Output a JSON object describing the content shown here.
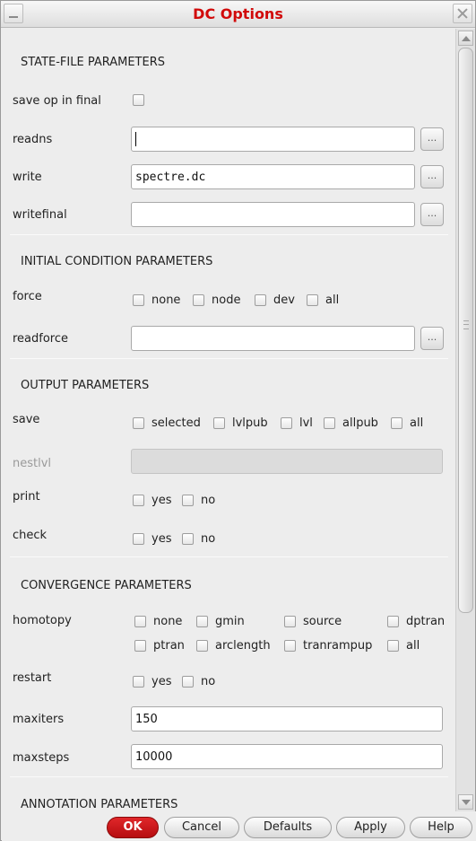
{
  "window": {
    "title": "DC Options"
  },
  "sections": {
    "state_file": {
      "title": "STATE-FILE PARAMETERS",
      "save_op_label": "save op in final",
      "readns_label": "readns",
      "readns_value": "",
      "write_label": "write",
      "write_value": "spectre.dc",
      "writefinal_label": "writefinal",
      "writefinal_value": "",
      "browse_label": "..."
    },
    "initial_condition": {
      "title": "INITIAL CONDITION PARAMETERS",
      "force_label": "force",
      "force_options": [
        "none",
        "node",
        "dev",
        "all"
      ],
      "readforce_label": "readforce",
      "readforce_value": ""
    },
    "output": {
      "title": "OUTPUT PARAMETERS",
      "save_label": "save",
      "save_options": [
        "selected",
        "lvlpub",
        "lvl",
        "allpub",
        "all"
      ],
      "nestlvl_label": "nestlvl",
      "print_label": "print",
      "print_options": [
        "yes",
        "no"
      ],
      "check_label": "check",
      "check_options": [
        "yes",
        "no"
      ]
    },
    "convergence": {
      "title": "CONVERGENCE PARAMETERS",
      "homotopy_label": "homotopy",
      "homotopy_options": [
        "none",
        "gmin",
        "source",
        "dptran",
        "ptran",
        "arclength",
        "tranrampup",
        "all"
      ],
      "restart_label": "restart",
      "restart_options": [
        "yes",
        "no"
      ],
      "maxiters_label": "maxiters",
      "maxiters_value": "150",
      "maxsteps_label": "maxsteps",
      "maxsteps_value": "10000"
    },
    "annotation": {
      "title": "ANNOTATION PARAMETERS"
    }
  },
  "buttons": {
    "ok": "OK",
    "cancel": "Cancel",
    "defaults": "Defaults",
    "apply": "Apply",
    "help": "Help"
  },
  "colors": {
    "title_red": "#d10a0a",
    "ok_red": "#c8161a"
  }
}
